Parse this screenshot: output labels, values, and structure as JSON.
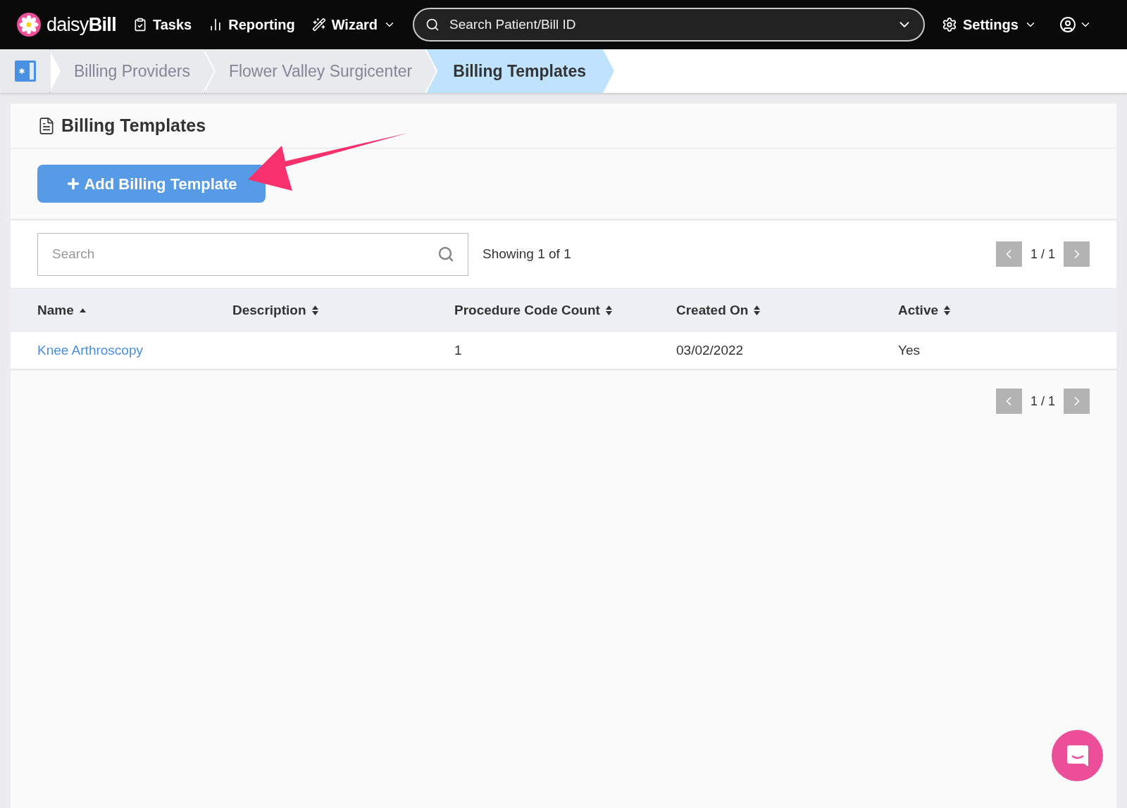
{
  "nav": {
    "logo": {
      "light": "daisy",
      "bold": "Bill"
    },
    "items": [
      {
        "kind": "tasks",
        "label": "Tasks",
        "dropdown": false
      },
      {
        "kind": "reporting",
        "label": "Reporting",
        "dropdown": false
      },
      {
        "kind": "wizard",
        "label": "Wizard",
        "dropdown": true
      }
    ],
    "search": {
      "placeholder": "Search Patient/Bill ID"
    },
    "settings": {
      "label": "Settings"
    }
  },
  "breadcrumb": [
    {
      "label": "Billing Providers",
      "selected": false
    },
    {
      "label": "Flower Valley Surgicenter",
      "selected": false
    },
    {
      "label": "Billing Templates",
      "selected": true
    }
  ],
  "panel": {
    "title": "Billing Templates",
    "add_button": "Add Billing Template",
    "search": {
      "placeholder": "Search"
    },
    "showing": "Showing 1 of 1",
    "pager_top": "1 / 1",
    "pager_bottom": "1 / 1",
    "table": {
      "columns": [
        {
          "label": "Name",
          "sorted": true
        },
        {
          "label": "Description",
          "sorted": false
        },
        {
          "label": "Procedure Code Count",
          "sorted": false
        },
        {
          "label": "Created On",
          "sorted": false
        },
        {
          "label": "Active",
          "sorted": false
        }
      ],
      "rows": [
        {
          "name": "Knee Arthroscopy",
          "count": "1",
          "created": "03/02/2022",
          "active": "Yes"
        }
      ]
    }
  }
}
